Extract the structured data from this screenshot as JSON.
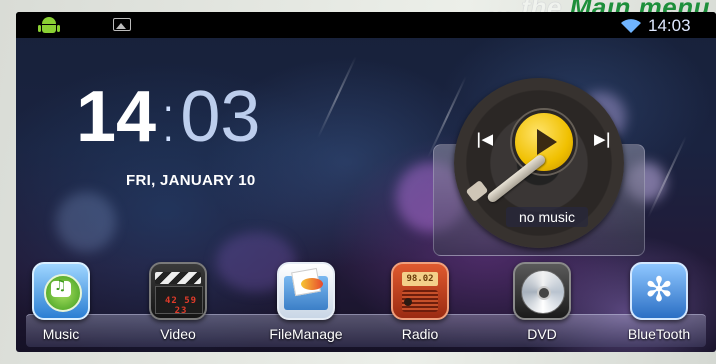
{
  "banner": {
    "prefix": "… the ",
    "text": "Main menu"
  },
  "status_bar": {
    "icons": [
      "android-icon",
      "image-icon",
      "wifi-icon"
    ],
    "time": "14:03"
  },
  "clock": {
    "hours": "14",
    "separator": ":",
    "minutes": "03"
  },
  "date": "FRI, JANUARY 10",
  "music_widget": {
    "status": "no music",
    "controls": [
      "previous",
      "play",
      "next"
    ],
    "prev_glyph": "|◀",
    "next_glyph": "▶|"
  },
  "dock": {
    "apps": [
      {
        "label": "Music",
        "icon": "music-app-icon"
      },
      {
        "label": "Video",
        "icon": "video-app-icon",
        "display": "42 59 23"
      },
      {
        "label": "FileManage",
        "icon": "file-manager-icon"
      },
      {
        "label": "Radio",
        "icon": "radio-app-icon",
        "display": "98.02"
      },
      {
        "label": "DVD",
        "icon": "dvd-app-icon"
      },
      {
        "label": "BlueTooth",
        "icon": "bluetooth-app-icon",
        "glyph": "✻"
      }
    ]
  },
  "colors": {
    "banner_green": "#1d8f3b",
    "accent_yellow": "#f0c000",
    "android_green": "#8ad034"
  }
}
